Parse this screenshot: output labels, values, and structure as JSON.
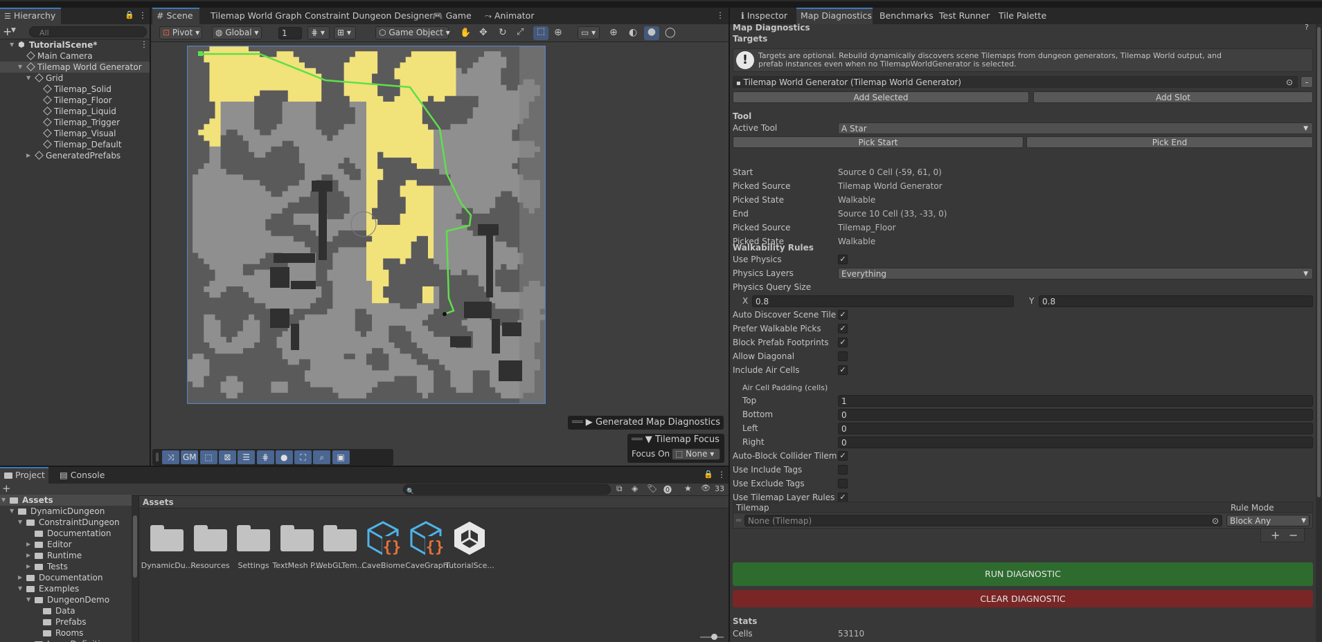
{
  "hierarchy": {
    "tab": "Hierarchy",
    "search_placeholder": "All",
    "items": [
      {
        "label": "TutorialScene*",
        "indent": 0
      },
      {
        "label": "Main Camera",
        "indent": 1
      },
      {
        "label": "Tilemap World Generator",
        "indent": 1
      },
      {
        "label": "Grid",
        "indent": 2
      },
      {
        "label": "Tilemap_Solid",
        "indent": 3
      },
      {
        "label": "Tilemap_Floor",
        "indent": 3
      },
      {
        "label": "Tilemap_Liquid",
        "indent": 3
      },
      {
        "label": "Tilemap_Trigger",
        "indent": 3
      },
      {
        "label": "Tilemap_Visual",
        "indent": 3
      },
      {
        "label": "Tilemap_Default",
        "indent": 3
      },
      {
        "label": "GeneratedPrefabs",
        "indent": 2
      }
    ]
  },
  "scene": {
    "tabs": [
      "Scene",
      "Tilemap World Graph",
      "Constraint Dungeon Designer",
      "Game",
      "Animator"
    ],
    "toolbar": {
      "pivot": "Pivot",
      "global": "Global",
      "grid_size": "1",
      "game_object": "Game Object"
    },
    "overlay_diag": "Generated Map Diagnostics",
    "overlay_focus_title": "Tilemap Focus",
    "focus_on_label": "Focus On",
    "focus_on_value": "None",
    "bottom_toolbar_gm": "GM"
  },
  "project": {
    "tabs": [
      "Project",
      "Console"
    ],
    "count": "33",
    "breadcrumb": "Assets",
    "tree": [
      {
        "label": "Assets",
        "indent": 0,
        "bold": true
      },
      {
        "label": "DynamicDungeon",
        "indent": 1
      },
      {
        "label": "ConstraintDungeon",
        "indent": 2
      },
      {
        "label": "Documentation",
        "indent": 3
      },
      {
        "label": "Editor",
        "indent": 3
      },
      {
        "label": "Runtime",
        "indent": 3
      },
      {
        "label": "Tests",
        "indent": 3
      },
      {
        "label": "Documentation",
        "indent": 2
      },
      {
        "label": "Examples",
        "indent": 2
      },
      {
        "label": "DungeonDemo",
        "indent": 3
      },
      {
        "label": "Data",
        "indent": 4
      },
      {
        "label": "Prefabs",
        "indent": 4
      },
      {
        "label": "Rooms",
        "indent": 4
      },
      {
        "label": "LayerDefinitions",
        "indent": 3
      }
    ],
    "assets": [
      {
        "label": "DynamicDu...",
        "kind": "folder"
      },
      {
        "label": "Resources",
        "kind": "folder"
      },
      {
        "label": "Settings",
        "kind": "folder"
      },
      {
        "label": "TextMesh P...",
        "kind": "folder"
      },
      {
        "label": "WebGLTem...",
        "kind": "folder"
      },
      {
        "label": "CaveBiome",
        "kind": "script"
      },
      {
        "label": "CaveGraph",
        "kind": "script"
      },
      {
        "label": "TutorialSce...",
        "kind": "unity"
      }
    ]
  },
  "inspector": {
    "tabs": [
      "Inspector",
      "Map Diagnostics",
      "Benchmarks",
      "Test Runner",
      "Tile Palette"
    ],
    "header": "Map Diagnostics",
    "targets_heading": "Targets",
    "info_text": "Targets are optional. Rebuild dynamically discovers scene Tilemaps from dungeon generators, Tilemap World output, and prefab instances even when no TilemapWorldGenerator is selected.",
    "target_value": "Tilemap World Generator (Tilemap World Generator)",
    "add_selected": "Add Selected",
    "add_slot": "Add Slot",
    "tool_heading": "Tool",
    "active_tool_label": "Active Tool",
    "active_tool_value": "A Star",
    "pick_start": "Pick Start",
    "pick_end": "Pick End",
    "info_rows": [
      {
        "label": "Start",
        "value": "Source 0 Cell (-59, 61, 0)"
      },
      {
        "label": "Picked Source",
        "value": "Tilemap World Generator"
      },
      {
        "label": "Picked State",
        "value": "Walkable"
      },
      {
        "label": "End",
        "value": "Source 10 Cell (33, -33, 0)"
      },
      {
        "label": "Picked Source",
        "value": "Tilemap_Floor"
      },
      {
        "label": "Picked State",
        "value": "Walkable"
      }
    ],
    "walk_heading": "Walkability Rules",
    "use_physics": "Use Physics",
    "physics_layers_label": "Physics Layers",
    "physics_layers_value": "Everything",
    "query_size_label": "Physics Query Size",
    "query_x_label": "X",
    "query_x": "0.8",
    "query_y_label": "Y",
    "query_y": "0.8",
    "toggles": [
      {
        "label": "Auto Discover Scene Tilemaps",
        "checked": true
      },
      {
        "label": "Prefer Walkable Picks",
        "checked": true
      },
      {
        "label": "Block Prefab Footprints",
        "checked": true
      },
      {
        "label": "Allow Diagonal",
        "checked": false
      },
      {
        "label": "Include Air Cells",
        "checked": true
      }
    ],
    "padding_heading": "Air Cell Padding (cells)",
    "padding": [
      {
        "label": "Top",
        "value": "1"
      },
      {
        "label": "Bottom",
        "value": "0"
      },
      {
        "label": "Left",
        "value": "0"
      },
      {
        "label": "Right",
        "value": "0"
      }
    ],
    "toggles2": [
      {
        "label": "Auto-Block Collider Tilemaps",
        "checked": true
      },
      {
        "label": "Use Include Tags",
        "checked": false
      },
      {
        "label": "Use Exclude Tags",
        "checked": false
      },
      {
        "label": "Use Tilemap Layer Rules",
        "checked": true
      }
    ],
    "list_col_tilemap": "Tilemap",
    "list_col_rule": "Rule Mode",
    "list_tilemap_value": "None (Tilemap)",
    "list_rule_value": "Block Any",
    "run_btn": "RUN DIAGNOSTIC",
    "clear_btn": "CLEAR DIAGNOSTIC",
    "stats_heading": "Stats",
    "cells_label": "Cells",
    "cells_value": "53110",
    "run_color": "#2e6b2e",
    "clear_color": "#7a2626"
  }
}
